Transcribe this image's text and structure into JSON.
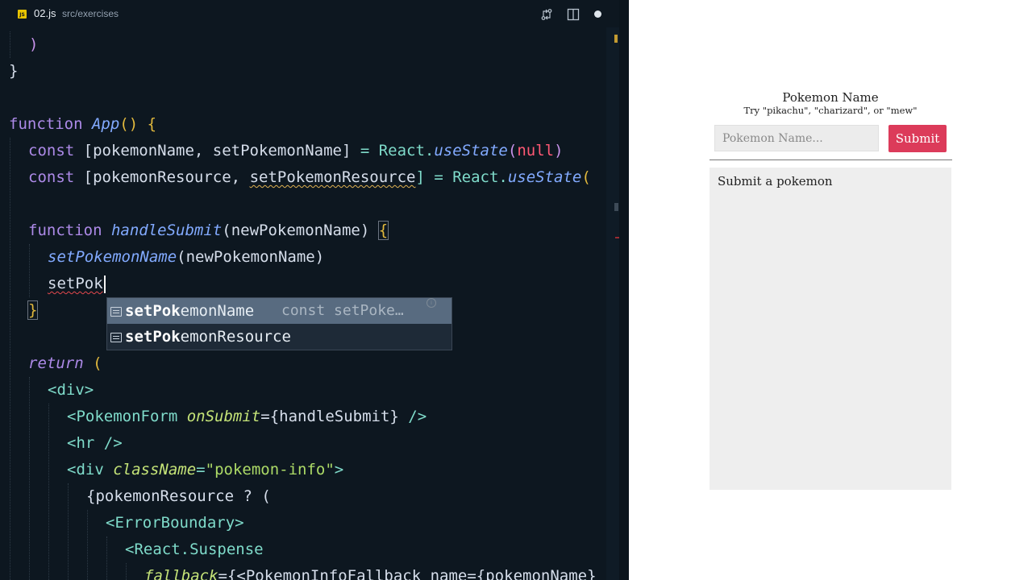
{
  "tab": {
    "file_icon_label": "JS",
    "filename": "02.js",
    "path": "src/exercises"
  },
  "toolbar": {
    "compare_icon": "compare-changes-icon",
    "split_icon": "split-editor-icon",
    "unsaved_icon": "unsaved-dot-icon"
  },
  "code": {
    "l1": ")",
    "l2": "}",
    "l4_kw": "function",
    "l4_name": "App",
    "l4_rest": "() {",
    "l5_kw": "const",
    "l5_a": "[pokemonName, setPokemonName]",
    "l5_b": " = React.",
    "l5_fn": "useState",
    "l5_c": "(",
    "l5_null": "null",
    "l5_d": ")",
    "l6_kw": "const",
    "l6_a": "[pokemonResource, ",
    "l6_squig": "setPokemonResource",
    "l6_b": "] = React.",
    "l6_fn": "useState",
    "l6_c": "(",
    "l8_kw": "function",
    "l8_name": "handleSubmit",
    "l8_rest": "(newPokemonName) ",
    "l8_brace": "{",
    "l9_fn": "setPokemonName",
    "l9_rest": "(newPokemonName)",
    "l10_typed": "setPok",
    "l11": "}",
    "l13_kw": "return",
    "l13_rest": " (",
    "l14": "<div>",
    "l15_tag": "<PokemonForm",
    "l15_attr": "onSubmit",
    "l15_val": "={handleSubmit}",
    "l15_end": " />",
    "l16": "<hr />",
    "l17_tag": "<div",
    "l17_attr": "className",
    "l17_eq": "=",
    "l17_str": "\"pokemon-info\"",
    "l17_end": ">",
    "l18_a": "{pokemonResource ? (",
    "l19": "<ErrorBoundary>",
    "l20": "<React.Suspense",
    "l21_attr": "fallback",
    "l21_rest": "={<PokemonInfoFallback name={pokemonName}"
  },
  "suggest": {
    "items": [
      {
        "match": "setPok",
        "rest": "emonName",
        "detail": "const setPoke…"
      },
      {
        "match": "setPok",
        "rest": "emonResource",
        "detail": ""
      }
    ],
    "info_icon": "info-icon"
  },
  "preview": {
    "title": "Pokemon Name",
    "hint": "Try \"pikachu\", \"charizard\", or \"mew\"",
    "input_placeholder": "Pokemon Name...",
    "submit_label": "Submit",
    "info_text": "Submit a pokemon",
    "accent": "#dc3b5a"
  }
}
